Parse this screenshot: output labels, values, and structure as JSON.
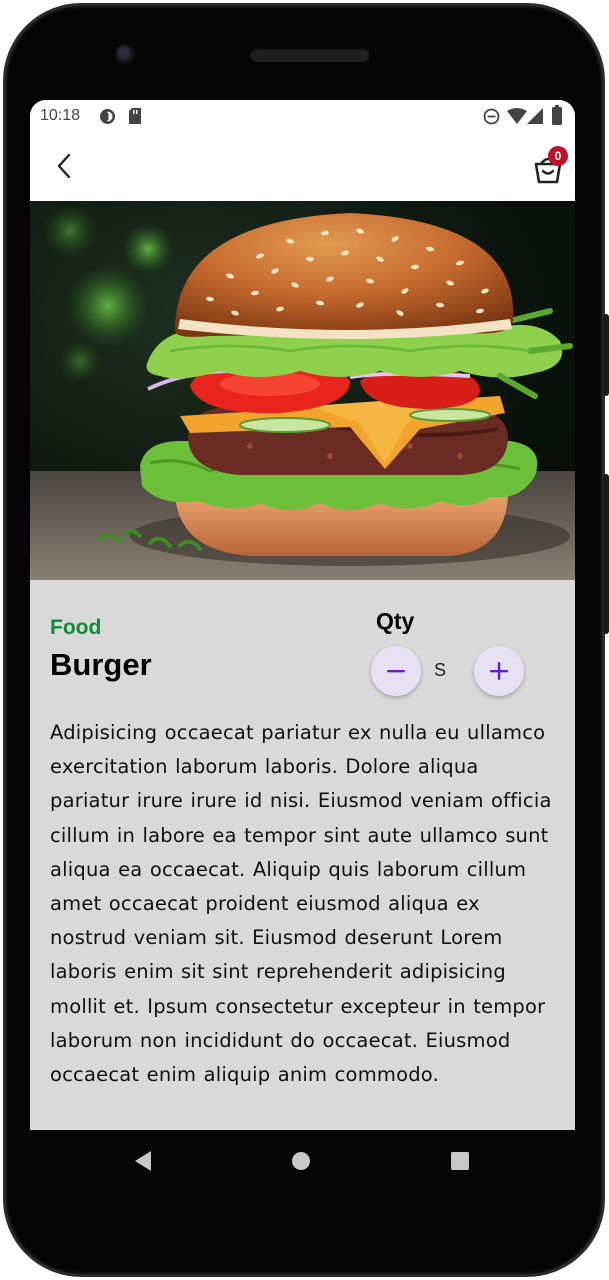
{
  "status_bar": {
    "time": "10:18",
    "left_icons": [
      "data-saver-icon",
      "sd-card-icon"
    ],
    "right_icons": [
      "do-not-disturb-icon",
      "wifi-icon",
      "signal-icon",
      "battery-icon"
    ]
  },
  "app_bar": {
    "back_icon": "chevron-left-icon",
    "cart_icon": "shopping-basket-icon",
    "cart_count": "0"
  },
  "product": {
    "image": "burger-photo",
    "category": "Food",
    "name": "Burger",
    "qty_label": "Qty",
    "size": "S",
    "description": "Adipisicing occaecat pariatur ex nulla eu ullamco exercitation laborum laboris. Dolore aliqua pariatur irure irure id nisi. Eiusmod veniam officia cillum in labore ea tempor sint aute ullamco sunt aliqua ea occaecat. Aliquip quis laborum cillum amet occaecat proident eiusmod aliqua ex nostrud veniam sit. Eiusmod deserunt Lorem laboris enim sit sint reprehenderit adipisicing mollit et. Ipsum consectetur excepteur in tempor laborum non incididunt do occaecat. Eiusmod occaecat enim aliquip anim commodo."
  },
  "colors": {
    "category": "#128a3c",
    "badge": "#c0102a",
    "qty_button_bg": "#e6e1f3",
    "qty_button_icon": "#5b21d6",
    "details_bg": "#d9d9d9"
  },
  "nav_bar": [
    "back-triangle-icon",
    "home-circle-icon",
    "overview-square-icon"
  ]
}
